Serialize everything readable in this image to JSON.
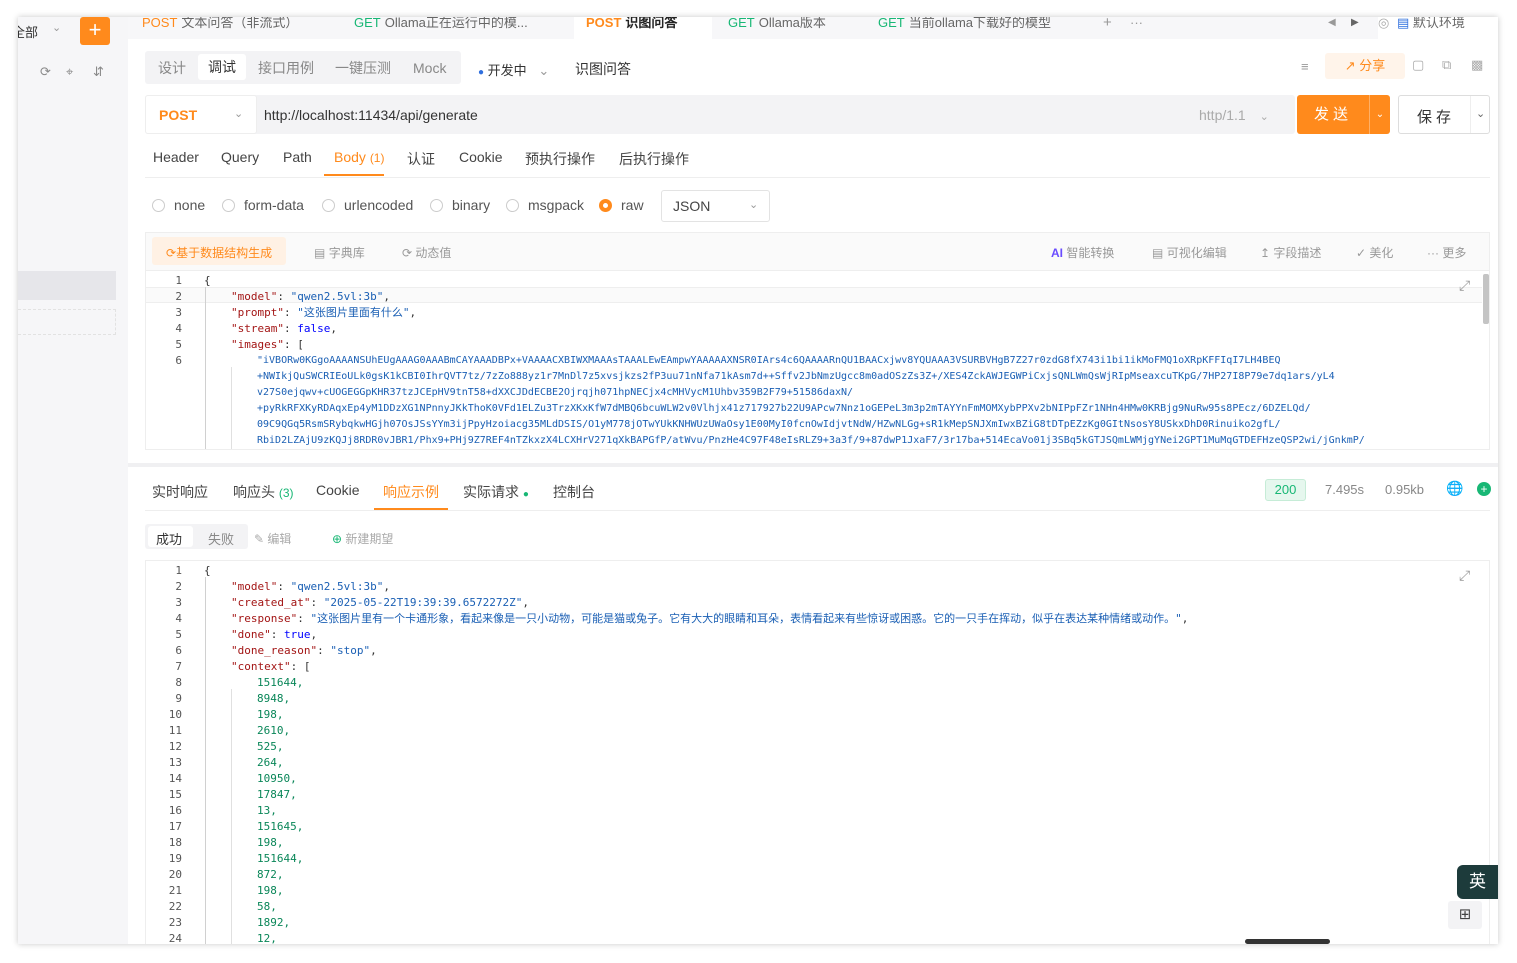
{
  "sidebar": {
    "filter_label": "全部",
    "add": "+"
  },
  "tabs": [
    {
      "method": "POST",
      "label": "文本问答（非流式）"
    },
    {
      "method": "GET",
      "label": "Ollama正在运行中的模..."
    },
    {
      "method": "POST",
      "label": "识图问答"
    },
    {
      "method": "GET",
      "label": "Ollama版本"
    },
    {
      "method": "GET",
      "label": "当前ollama下载好的模型"
    }
  ],
  "tab_add": "+",
  "tab_more": "···",
  "env": "默认环境",
  "seg": [
    "设计",
    "调试",
    "接口用例",
    "一键压测",
    "Mock"
  ],
  "status": "开发中",
  "api_name": "识图问答",
  "share": "分享",
  "method": "POST",
  "url": "http://localhost:11434/api/generate",
  "http_ver": "http/1.1",
  "send": "发送",
  "save": "保存",
  "param_tabs": [
    "Header",
    "Query",
    "Path",
    "Body",
    "认证",
    "Cookie",
    "预执行操作",
    "后执行操作"
  ],
  "body_count": "(1)",
  "body_types": [
    "none",
    "form-data",
    "urlencoded",
    "binary",
    "msgpack",
    "raw"
  ],
  "body_format": "JSON",
  "toolbar": {
    "gen": "基于数据结构生成",
    "lib": "字典库",
    "dyn": "动态值",
    "ai_mark": "AI",
    "ai": "智能转换",
    "visual": "可视化编辑",
    "field": "字段描述",
    "beautify": "美化",
    "more": "更多"
  },
  "req_lines": [
    "1",
    "2",
    "3",
    "4",
    "5",
    "6"
  ],
  "req_code": {
    "l1": "{",
    "model_k": "\"model\"",
    "model_v": "\"qwen2.5vl:3b\"",
    "prompt_k": "\"prompt\"",
    "prompt_v": "\"这张图片里面有什么\"",
    "stream_k": "\"stream\"",
    "stream_v": "false",
    "images_k": "\"images\"",
    "images_open": "[",
    "img1": "\"iVBORw0KGgoAAAANSUhEUgAAAG0AAABmCAYAAADBPx+VAAAACXBIWXMAAAsTAAALEwEAmpwYAAAAAXNSR0IArs4c6QAAAARnQU1BAACxjwv8YQUAAA3VSURBVHgB7Z27r0zdG8fX743i1bi1ikMoFMQ1oXRpKFFIqI7LH4BEQ",
    "img2": "+NWIkjQuSWCRIEoULk0gsK1kCBI0IhrQVT7tz/7zZo888yz1r7MnDl7z5xvsjkzs2fP3uu71nNfa71kAsm7d++Sffv2JbNmzUgcc8m0adOSzZs3Z+/XES4ZckAWJEGWPiCxjsQNLWmQsWjRIpMseaxcuTKpG/7HP27I8P79e7dq1ars/yL4",
    "img3": "v27S0ejqwv+cUOGEGGpKHR37tzJCEpHV9tnT58+dXXCJDdECBE2Ojrqjh071hpNECjx4cMHVycM1Uhbv359B2F79+51586daxN/",
    "img4": "+pyRkRFXKyRDAqxEp4yM1DDzXG1NPnnyJKkThoK0VFd1ELZu3TrzXKxKfW7dMBQ6bcuWLW2v0Vlhjx41z717927b22U9APcw7Nnz1oGEPeL3m3p2mTAYYnFmMOMXybPPXv2bNIPpFZr1NHn4HMw0KRBjg9NuRw95s8PEcz/6DZELQd/",
    "img5": "09C9QGq5RsmSRybqkwHGjh07OsJSsYYm3ijPpyHzoiacg35MLdDSIS/O1yM778jOTwYUkKNHWUzUWaOsy1E00MyI0fcnOwIdjvtNdW/HZwNLGg+sR1kMepSNJXmIwxBZiG8tDTpEZzKg0GItNsosY8USkxDhD0Rinuiko2gfL/",
    "img6": "RbiD2LZAjU9zKQJj8RDR0vJBR1/Phx9+PHj9Z7REF4nTZkxzX4LCXHrV271qXkBAPGfP/atWvu/PnzHe4C97F48eIsRLZ9+3a3f/9+87dwP1JxaF7/3r17ba+514EcaVo01j3SBq5kGTJSQmLWMjgYNei2GPT1MuMqGTDEFHzeQSP2wi/jGnkmP/"
  },
  "resp_tabs": [
    "实时响应",
    "响应头",
    "Cookie",
    "响应示例",
    "实际请求",
    "控制台"
  ],
  "resp_header_count": "(3)",
  "resp_status": "200",
  "resp_time": "7.495s",
  "resp_size": "0.95kb",
  "resp_sub": {
    "ok": "成功",
    "fail": "失败",
    "edit": "编辑",
    "new": "新建期望"
  },
  "resp_lines": [
    "1",
    "2",
    "3",
    "4",
    "5",
    "6",
    "7",
    "8",
    "9",
    "10",
    "11",
    "12",
    "13",
    "14",
    "15",
    "16",
    "17",
    "18",
    "19",
    "20",
    "21",
    "22",
    "23",
    "24"
  ],
  "resp_code": {
    "l1": "{",
    "model_k": "\"model\"",
    "model_v": "\"qwen2.5vl:3b\"",
    "created_k": "\"created_at\"",
    "created_v": "\"2025-05-22T19:39:39.6572272Z\"",
    "response_k": "\"response\"",
    "response_v": "\"这张图片里有一个卡通形象，看起来像是一只小动物，可能是猫或兔子。它有大大的眼睛和耳朵，表情看起来有些惊讶或困惑。它的一只手在挥动，似乎在表达某种情绪或动作。\"",
    "done_k": "\"done\"",
    "done_v": "true",
    "reason_k": "\"done_reason\"",
    "reason_v": "\"stop\"",
    "context_k": "\"context\"",
    "context_open": "[",
    "context_vals": [
      "151644",
      "8948",
      "198",
      "2610",
      "525",
      "264",
      "10950",
      "17847",
      "13",
      "151645",
      "198",
      "151644",
      "872",
      "198",
      "58",
      "1892",
      "12"
    ]
  },
  "ime": "英"
}
